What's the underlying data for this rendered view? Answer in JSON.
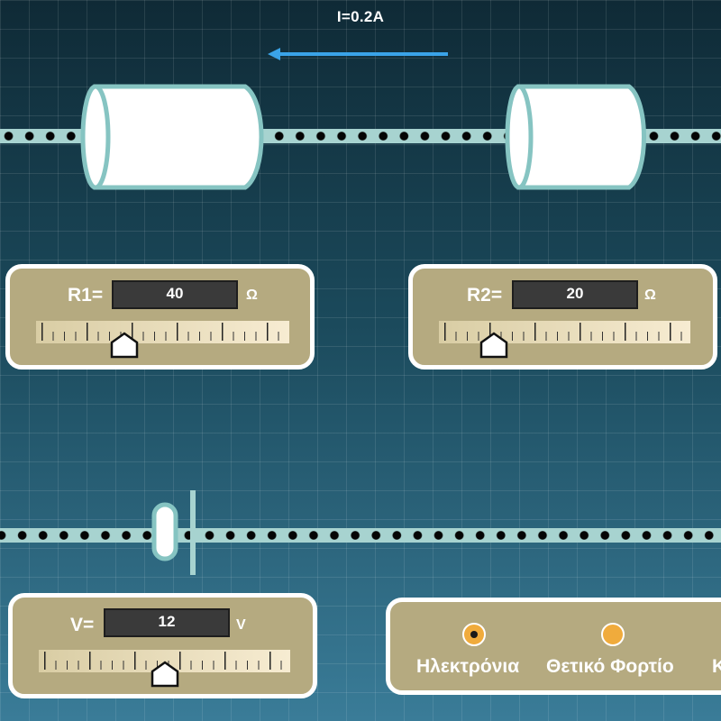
{
  "circuit": {
    "current_label": "I=0.2A",
    "current_direction": "left"
  },
  "resistor1": {
    "label": "R1=",
    "value": "40",
    "unit": "Ω",
    "slider_fraction": 0.35
  },
  "resistor2": {
    "label": "R2=",
    "value": "20",
    "unit": "Ω",
    "slider_fraction": 0.22
  },
  "voltage": {
    "label": "V=",
    "value": "12",
    "unit": "V",
    "slider_fraction": 0.5
  },
  "legend": {
    "electrons_label": "Ηλεκτρόνια",
    "positive_charge_label": "Θετικό Φορτίο",
    "third_label_partial": "Κ",
    "selected": "electrons"
  },
  "colors": {
    "wire": "#a7d3d0",
    "panel": "#b5aa80",
    "radio": "#f0ab3c",
    "arrow": "#3aa3e8"
  }
}
